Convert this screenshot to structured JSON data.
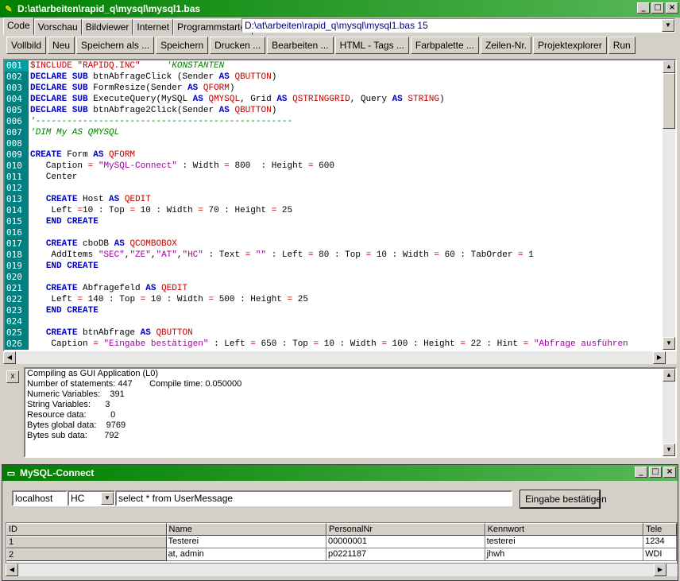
{
  "window": {
    "title": "D:\\at\\arbeiten\\rapid_q\\mysql\\mysql1.bas",
    "controls": [
      "_",
      "□",
      "×"
    ]
  },
  "tabs": [
    "Code",
    "Vorschau",
    "Bildviewer",
    "Internet",
    "Programmstarter"
  ],
  "path": "D:\\at\\arbeiten\\rapid_q\\mysql\\mysql1.bas 15",
  "toolbar": [
    "Vollbild",
    "Neu",
    "Speichern als ...",
    "Speichern",
    "Drucken ...",
    "Bearbeiten ...",
    "HTML - Tags ...",
    "Farbpalette ...",
    "Zeilen-Nr.",
    "Projektexplorer",
    "Run"
  ],
  "line_numbers": [
    "001",
    "002",
    "003",
    "004",
    "005",
    "006",
    "007",
    "008",
    "009",
    "010",
    "011",
    "012",
    "013",
    "014",
    "015",
    "016",
    "017",
    "018",
    "019",
    "020",
    "021",
    "022",
    "023",
    "024",
    "025",
    "026"
  ],
  "code_lines": [
    [
      [
        "pp",
        "$INCLUDE \"RAPIDQ.INC\""
      ],
      [
        "",
        "     "
      ],
      [
        "cm",
        "'KONSTANTEN"
      ]
    ],
    [
      [
        "kw",
        "DECLARE"
      ],
      [
        "",
        " "
      ],
      [
        "kw",
        "SUB"
      ],
      [
        "",
        " btnAbfrageClick (Sender "
      ],
      [
        "kw",
        "AS"
      ],
      [
        "",
        " "
      ],
      [
        "ty",
        "QBUTTON"
      ],
      [
        "",
        ")"
      ]
    ],
    [
      [
        "kw",
        "DECLARE"
      ],
      [
        "",
        " "
      ],
      [
        "kw",
        "SUB"
      ],
      [
        "",
        " FormResize(Sender "
      ],
      [
        "kw",
        "AS"
      ],
      [
        "",
        " "
      ],
      [
        "ty",
        "QFORM"
      ],
      [
        "",
        ")"
      ]
    ],
    [
      [
        "kw",
        "DECLARE"
      ],
      [
        "",
        " "
      ],
      [
        "kw",
        "SUB"
      ],
      [
        "",
        " ExecuteQuery(MySQL "
      ],
      [
        "kw",
        "AS"
      ],
      [
        "",
        " "
      ],
      [
        "ty",
        "QMYSQL"
      ],
      [
        "",
        ", Grid "
      ],
      [
        "kw",
        "AS"
      ],
      [
        "",
        " "
      ],
      [
        "ty",
        "QSTRINGGRID"
      ],
      [
        "",
        ", Query "
      ],
      [
        "kw",
        "AS"
      ],
      [
        "",
        " "
      ],
      [
        "ty",
        "STRING"
      ],
      [
        "",
        ")"
      ]
    ],
    [
      [
        "kw",
        "DECLARE"
      ],
      [
        "",
        " "
      ],
      [
        "kw",
        "SUB"
      ],
      [
        "",
        " btnAbfrage2Click(Sender "
      ],
      [
        "kw",
        "AS"
      ],
      [
        "",
        " "
      ],
      [
        "ty",
        "QBUTTON"
      ],
      [
        "",
        ")"
      ]
    ],
    [
      [
        "cm",
        "'-------------------------------------------------"
      ]
    ],
    [
      [
        "cm",
        "'DIM My AS QMYSQL"
      ]
    ],
    [
      [
        "",
        ""
      ]
    ],
    [
      [
        "kw",
        "CREATE"
      ],
      [
        "",
        " Form "
      ],
      [
        "kw",
        "AS"
      ],
      [
        "",
        " "
      ],
      [
        "ty",
        "QFORM"
      ]
    ],
    [
      [
        "",
        "   Caption "
      ],
      [
        "op",
        "="
      ],
      [
        "",
        " "
      ],
      [
        "st",
        "\"MySQL-Connect\""
      ],
      [
        "",
        " : Width "
      ],
      [
        "op",
        "="
      ],
      [
        "",
        " 800  : Height "
      ],
      [
        "op",
        "="
      ],
      [
        "",
        " 600"
      ]
    ],
    [
      [
        "",
        "   Center"
      ]
    ],
    [
      [
        "",
        ""
      ]
    ],
    [
      [
        "",
        "   "
      ],
      [
        "kw",
        "CREATE"
      ],
      [
        "",
        " Host "
      ],
      [
        "kw",
        "AS"
      ],
      [
        "",
        " "
      ],
      [
        "ty",
        "QEDIT"
      ]
    ],
    [
      [
        "",
        "    Left "
      ],
      [
        "op",
        "="
      ],
      [
        "",
        "10 : Top "
      ],
      [
        "op",
        "="
      ],
      [
        "",
        " 10 : Width "
      ],
      [
        "op",
        "="
      ],
      [
        "",
        " 70 : Height "
      ],
      [
        "op",
        "="
      ],
      [
        "",
        " 25"
      ]
    ],
    [
      [
        "",
        "   "
      ],
      [
        "kw",
        "END"
      ],
      [
        "",
        " "
      ],
      [
        "kw",
        "CREATE"
      ]
    ],
    [
      [
        "",
        ""
      ]
    ],
    [
      [
        "",
        "   "
      ],
      [
        "kw",
        "CREATE"
      ],
      [
        "",
        " cboDB "
      ],
      [
        "kw",
        "AS"
      ],
      [
        "",
        " "
      ],
      [
        "ty",
        "QCOMBOBOX"
      ]
    ],
    [
      [
        "",
        "    AddItems "
      ],
      [
        "st",
        "\"SEC\""
      ],
      [
        "",
        ","
      ],
      [
        "st",
        "\"ZE\""
      ],
      [
        "",
        ","
      ],
      [
        "st",
        "\"AT\""
      ],
      [
        "",
        ","
      ],
      [
        "st",
        "\"HC\""
      ],
      [
        "",
        " : Text "
      ],
      [
        "op",
        "="
      ],
      [
        "",
        " "
      ],
      [
        "st",
        "\"\""
      ],
      [
        "",
        " : Left "
      ],
      [
        "op",
        "="
      ],
      [
        "",
        " 80 : Top "
      ],
      [
        "op",
        "="
      ],
      [
        "",
        " 10 : Width "
      ],
      [
        "op",
        "="
      ],
      [
        "",
        " 60 : TabOrder "
      ],
      [
        "op",
        "="
      ],
      [
        "",
        " 1"
      ]
    ],
    [
      [
        "",
        "   "
      ],
      [
        "kw",
        "END"
      ],
      [
        "",
        " "
      ],
      [
        "kw",
        "CREATE"
      ]
    ],
    [
      [
        "",
        ""
      ]
    ],
    [
      [
        "",
        "   "
      ],
      [
        "kw",
        "CREATE"
      ],
      [
        "",
        " Abfragefeld "
      ],
      [
        "kw",
        "AS"
      ],
      [
        "",
        " "
      ],
      [
        "ty",
        "QEDIT"
      ]
    ],
    [
      [
        "",
        "    Left "
      ],
      [
        "op",
        "="
      ],
      [
        "",
        " 140 : Top "
      ],
      [
        "op",
        "="
      ],
      [
        "",
        " 10 : Width "
      ],
      [
        "op",
        "="
      ],
      [
        "",
        " 500 : Height "
      ],
      [
        "op",
        "="
      ],
      [
        "",
        " 25"
      ]
    ],
    [
      [
        "",
        "   "
      ],
      [
        "kw",
        "END"
      ],
      [
        "",
        " "
      ],
      [
        "kw",
        "CREATE"
      ]
    ],
    [
      [
        "",
        ""
      ]
    ],
    [
      [
        "",
        "   "
      ],
      [
        "kw",
        "CREATE"
      ],
      [
        "",
        " btnAbfrage "
      ],
      [
        "kw",
        "AS"
      ],
      [
        "",
        " "
      ],
      [
        "ty",
        "QBUTTON"
      ]
    ],
    [
      [
        "",
        "    Caption "
      ],
      [
        "op",
        "="
      ],
      [
        "",
        " "
      ],
      [
        "st",
        "\"Eingabe bestätigen\""
      ],
      [
        "",
        " : Left "
      ],
      [
        "op",
        "="
      ],
      [
        "",
        " 650 : Top "
      ],
      [
        "op",
        "="
      ],
      [
        "",
        " 10 : Width "
      ],
      [
        "op",
        "="
      ],
      [
        "",
        " 100 : Height "
      ],
      [
        "op",
        "="
      ],
      [
        "",
        " 22 : Hint "
      ],
      [
        "op",
        "="
      ],
      [
        "",
        " "
      ],
      [
        "st",
        "\"Abfrage ausführen"
      ]
    ]
  ],
  "syntax_colors": {
    "kw": "#0000c0",
    "ty": "#c00000",
    "st": "#a000a0",
    "cm": "#008000",
    "pp": "#c00000",
    "op": "#c00000"
  },
  "output_lines": [
    "Compiling as GUI Application (L0)",
    "Number of statements: 447       Compile time: 0.050000",
    "Numeric Variables:    391",
    "String Variables:      3",
    "Resource data:          0",
    "Bytes global data:    9769",
    "Bytes sub data:       792"
  ],
  "output_close": "x",
  "mysql_window": {
    "title": "MySQL-Connect",
    "host": "localhost",
    "db": "HC",
    "query": "select * from UserMessage",
    "button": "Eingabe bestätigen"
  },
  "grid": {
    "headers": [
      "ID",
      "Name",
      "PersonalNr",
      "Kennwort",
      "Tele"
    ],
    "rows": [
      [
        "1",
        "Testerei",
        "00000001",
        "testerei",
        "1234"
      ],
      [
        "2",
        "at, admin",
        "p0221187",
        "jhwh",
        "WDI"
      ]
    ]
  }
}
